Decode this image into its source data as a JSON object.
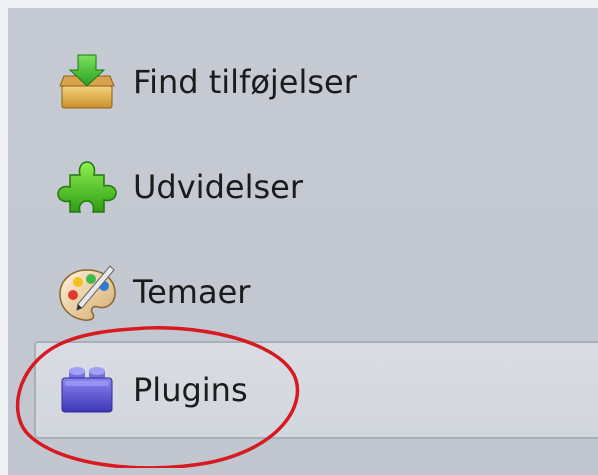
{
  "sidebar": {
    "items": [
      {
        "label": "Find tilføjelser",
        "icon": "download-box-icon",
        "selected": false
      },
      {
        "label": "Udvidelser",
        "icon": "puzzle-piece-icon",
        "selected": false
      },
      {
        "label": "Temaer",
        "icon": "paint-palette-icon",
        "selected": false
      },
      {
        "label": "Plugins",
        "icon": "lego-brick-icon",
        "selected": true
      }
    ]
  },
  "annotation": {
    "color": "#d71920",
    "target": "Plugins"
  }
}
